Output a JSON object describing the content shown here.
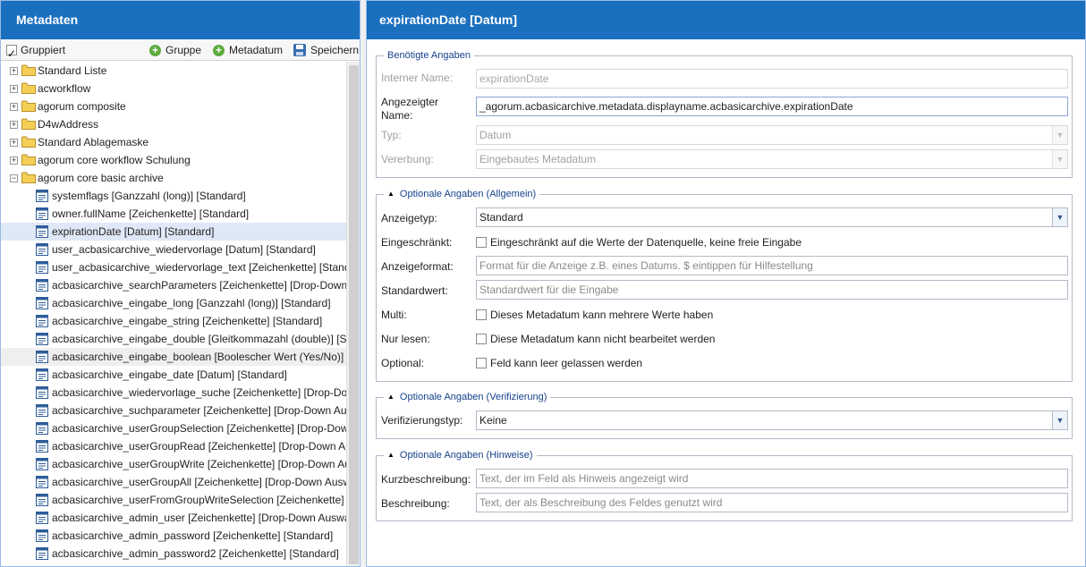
{
  "left": {
    "title": "Metadaten",
    "toolbar": {
      "grouped_label": "Gruppiert",
      "group_label": "Gruppe",
      "metadata_label": "Metadatum",
      "save_label": "Speichern"
    },
    "folders": [
      "Standard Liste",
      "acworkflow",
      "agorum composite",
      "D4wAddress",
      "Standard Ablagemaske",
      "agorum core workflow Schulung",
      "agorum core basic archive"
    ],
    "leaves": [
      "systemflags [Ganzzahl (long)] [Standard]",
      "owner.fullName [Zeichenkette] [Standard]",
      "expirationDate [Datum] [Standard]",
      "user_acbasicarchive_wiedervorlage [Datum] [Standard]",
      "user_acbasicarchive_wiedervorlage_text [Zeichenkette] [Standar...",
      "acbasicarchive_searchParameters [Zeichenkette] [Drop-Down Au...",
      "acbasicarchive_eingabe_long [Ganzzahl (long)] [Standard]",
      "acbasicarchive_eingabe_string [Zeichenkette] [Standard]",
      "acbasicarchive_eingabe_double [Gleitkommazahl (double)] [Stan...",
      "acbasicarchive_eingabe_boolean [Boolescher Wert (Yes/No)] [St...",
      "acbasicarchive_eingabe_date [Datum] [Standard]",
      "acbasicarchive_wiedervorlage_suche [Zeichenkette] [Drop-Down ...",
      "acbasicarchive_suchparameter [Zeichenkette] [Drop-Down Auswa...",
      "acbasicarchive_userGroupSelection [Zeichenkette] [Drop-Down A...",
      "acbasicarchive_userGroupRead [Zeichenkette] [Drop-Down Auswa...",
      "acbasicarchive_userGroupWrite [Zeichenkette] [Drop-Down Ausw...",
      "acbasicarchive_userGroupAll [Zeichenkette] [Drop-Down Auswahl]",
      "acbasicarchive_userFromGroupWriteSelection [Zeichenkette] [Dr...",
      "acbasicarchive_admin_user [Zeichenkette] [Drop-Down Auswahl]",
      "acbasicarchive_admin_password [Zeichenkette] [Standard]",
      "acbasicarchive_admin_password2 [Zeichenkette] [Standard]"
    ]
  },
  "right": {
    "title": "expirationDate [Datum]",
    "required": {
      "legend": "Benötigte Angaben",
      "internal_name_label": "Interner Name:",
      "internal_name_value": "expirationDate",
      "display_name_label": "Angezeigter Name:",
      "display_name_value": "_agorum.acbasicarchive.metadata.displayname.acbasicarchive.expirationDate",
      "type_label": "Typ:",
      "type_value": "Datum",
      "inheritance_label": "Vererbung:",
      "inheritance_value": "Eingebautes Metadatum"
    },
    "optional_general": {
      "legend": "Optionale Angaben (Allgemein)",
      "display_type_label": "Anzeigetyp:",
      "display_type_value": "Standard",
      "restricted_label": "Eingeschränkt:",
      "restricted_text": "Eingeschränkt auf die Werte der Datenquelle, keine freie Eingabe",
      "format_label": "Anzeigeformat:",
      "format_placeholder": "Format für die Anzeige z.B. eines Datums. $ eintippen für Hilfestellung",
      "default_label": "Standardwert:",
      "default_placeholder": "Standardwert für die Eingabe",
      "multi_label": "Multi:",
      "multi_text": "Dieses Metadatum kann mehrere Werte haben",
      "readonly_label": "Nur lesen:",
      "readonly_text": "Diese Metadatum kann nicht bearbeitet werden",
      "optional_label": "Optional:",
      "optional_text": "Feld kann leer gelassen werden"
    },
    "optional_verification": {
      "legend": "Optionale Angaben (Verifizierung)",
      "type_label": "Verifizierungstyp:",
      "type_value": "Keine"
    },
    "optional_hints": {
      "legend": "Optionale Angaben (Hinweise)",
      "short_label": "Kurzbeschreibung:",
      "short_placeholder": "Text, der im Feld als Hinweis angezeigt wird",
      "desc_label": "Beschreibung:",
      "desc_placeholder": "Text, der als Beschreibung des Feldes genutzt wird"
    }
  },
  "colors": {
    "header_bg": "#1a6fbf",
    "selected_row": "#dfe8f6",
    "legend_text": "#15428b",
    "folder": "#f0c94a"
  }
}
